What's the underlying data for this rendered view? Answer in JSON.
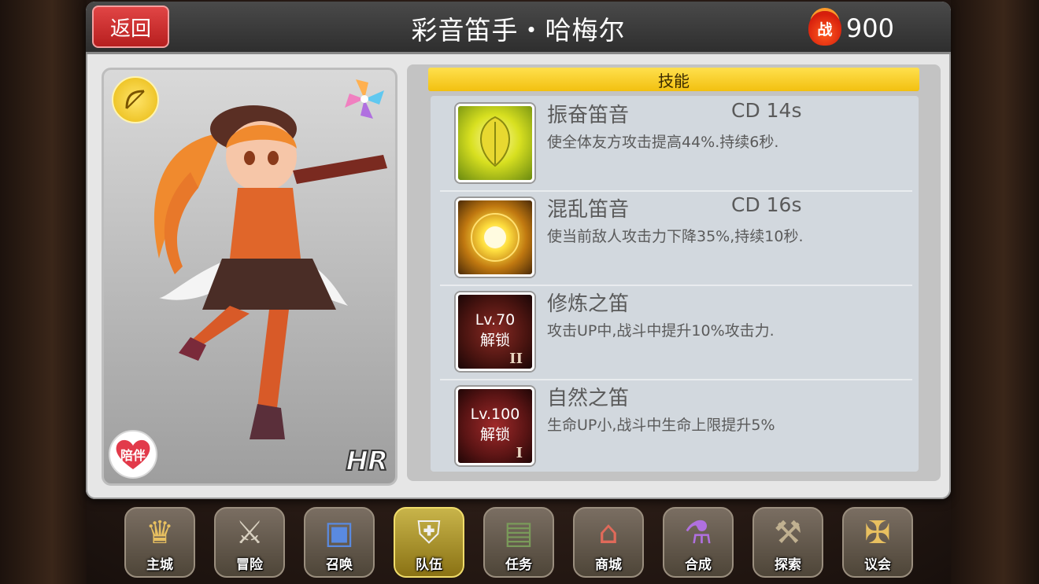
{
  "header": {
    "back_label": "返回",
    "title": "彩音笛手・哈梅尔",
    "power_icon": "战",
    "power_value": "900"
  },
  "character": {
    "companion_label": "陪伴",
    "rarity": "HR"
  },
  "skills": {
    "header": "技能",
    "items": [
      {
        "name": "振奋笛音",
        "cd": "CD  14s",
        "desc": "使全体友方攻击提高44%.持续6秒.",
        "icon": "leaf-buff-icon"
      },
      {
        "name": "混乱笛音",
        "cd": "CD  16s",
        "desc": "使当前敌人攻击力下降35%,持续10秒.",
        "icon": "burst-debuff-icon"
      },
      {
        "name": "修炼之笛",
        "cd": "",
        "desc": "攻击UP中,战斗中提升10%攻击力.",
        "icon": "locked-skill-icon",
        "lock_level": "Lv.70",
        "lock_text": "解锁",
        "roman": "II"
      },
      {
        "name": "自然之笛",
        "cd": "",
        "desc": "生命UP小,战斗中生命上限提升5%",
        "icon": "locked-skill-icon",
        "lock_level": "Lv.100",
        "lock_text": "解锁",
        "roman": "I"
      }
    ]
  },
  "nav": [
    {
      "label": "主城",
      "icon": "crown-icon"
    },
    {
      "label": "冒险",
      "icon": "crossed-weapons-icon"
    },
    {
      "label": "召唤",
      "icon": "summon-card-icon"
    },
    {
      "label": "队伍",
      "icon": "winged-shield-icon",
      "active": true
    },
    {
      "label": "任务",
      "icon": "quest-book-icon"
    },
    {
      "label": "商城",
      "icon": "shop-tent-icon"
    },
    {
      "label": "合成",
      "icon": "potion-flask-icon"
    },
    {
      "label": "探索",
      "icon": "shovel-icon"
    },
    {
      "label": "议会",
      "icon": "council-crest-icon"
    }
  ]
}
